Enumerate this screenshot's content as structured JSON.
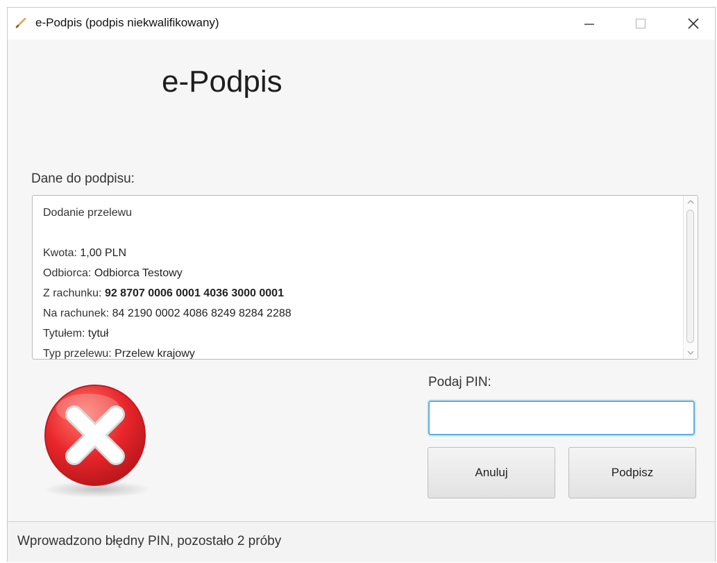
{
  "window": {
    "title": "e-Podpis (podpis niekwalifikowany)",
    "icons": {
      "app": "pen-icon",
      "minimize": "minimize-icon",
      "maximize": "maximize-icon",
      "close": "close-icon"
    }
  },
  "main": {
    "app_title": "e-Podpis",
    "data_label": "Dane do podpisu:",
    "data_lines": [
      {
        "label": "Dodanie przelewu",
        "value": ""
      },
      {
        "label": "",
        "value": ""
      },
      {
        "label": "Kwota: ",
        "value": "1,00 PLN"
      },
      {
        "label": "Odbiorca: ",
        "value": " Odbiorca Testowy"
      },
      {
        "label": "Z rachunku: ",
        "value": "92 8707 0006 0001 4036 3000 0001"
      },
      {
        "label": "Na rachunek: ",
        "value": "84 2190 0002 4086 8249 8284 2288"
      },
      {
        "label": "Tytułem: ",
        "value": "tytuł"
      },
      {
        "label": "Typ przelewu: ",
        "value": "Przelew krajowy"
      }
    ],
    "error_icon": "error-x-icon",
    "pin": {
      "label": "Podaj PIN:",
      "value": "",
      "placeholder": ""
    },
    "buttons": {
      "cancel": "Anuluj",
      "sign": "Podpisz"
    }
  },
  "status": {
    "message": "Wprowadzono błędny PIN, pozostało 2 próby"
  },
  "colors": {
    "error_red": "#e8262b",
    "focus_blue": "#5aaee6"
  }
}
